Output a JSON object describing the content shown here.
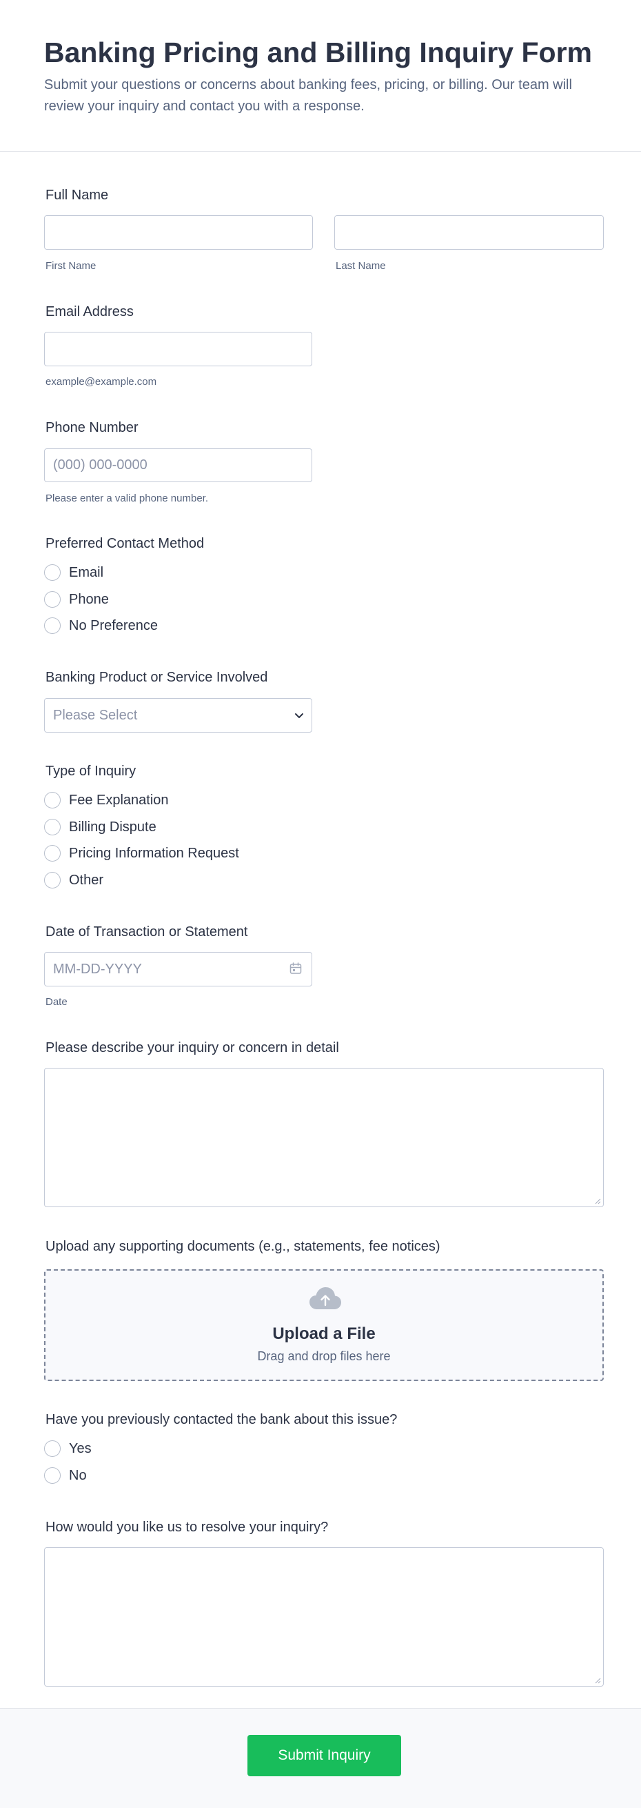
{
  "header": {
    "title": "Banking Pricing and Billing Inquiry Form",
    "subtitle": "Submit your questions or concerns about banking fees, pricing, or billing. Our team will review your inquiry and contact you with a response."
  },
  "full_name": {
    "label": "Full Name",
    "first_sublabel": "First Name",
    "last_sublabel": "Last Name",
    "first_value": "",
    "last_value": ""
  },
  "email": {
    "label": "Email Address",
    "sublabel": "example@example.com",
    "value": ""
  },
  "phone": {
    "label": "Phone Number",
    "placeholder": "(000) 000-0000",
    "sublabel": "Please enter a valid phone number.",
    "value": ""
  },
  "contact_method": {
    "label": "Preferred Contact Method",
    "options": [
      "Email",
      "Phone",
      "No Preference"
    ]
  },
  "product": {
    "label": "Banking Product or Service Involved",
    "selected": "Please Select"
  },
  "inquiry_type": {
    "label": "Type of Inquiry",
    "options": [
      "Fee Explanation",
      "Billing Dispute",
      "Pricing Information Request",
      "Other"
    ]
  },
  "date": {
    "label": "Date of Transaction or Statement",
    "placeholder": "MM-DD-YYYY",
    "sublabel": "Date",
    "icon": "calendar-icon",
    "value": ""
  },
  "description": {
    "label": "Please describe your inquiry or concern in detail",
    "value": ""
  },
  "upload": {
    "label": "Upload any supporting documents (e.g., statements, fee notices)",
    "icon": "cloud-upload-icon",
    "title": "Upload a File",
    "subtitle": "Drag and drop files here"
  },
  "previous_contact": {
    "label": "Have you previously contacted the bank about this issue?",
    "options": [
      "Yes",
      "No"
    ]
  },
  "resolution": {
    "label": "How would you like us to resolve your inquiry?",
    "value": ""
  },
  "submit": {
    "label": "Submit Inquiry"
  },
  "colors": {
    "primary_text": "#2c3345",
    "secondary_text": "#57647e",
    "border": "#c3cad8",
    "submit_button": "#18bd5b"
  }
}
